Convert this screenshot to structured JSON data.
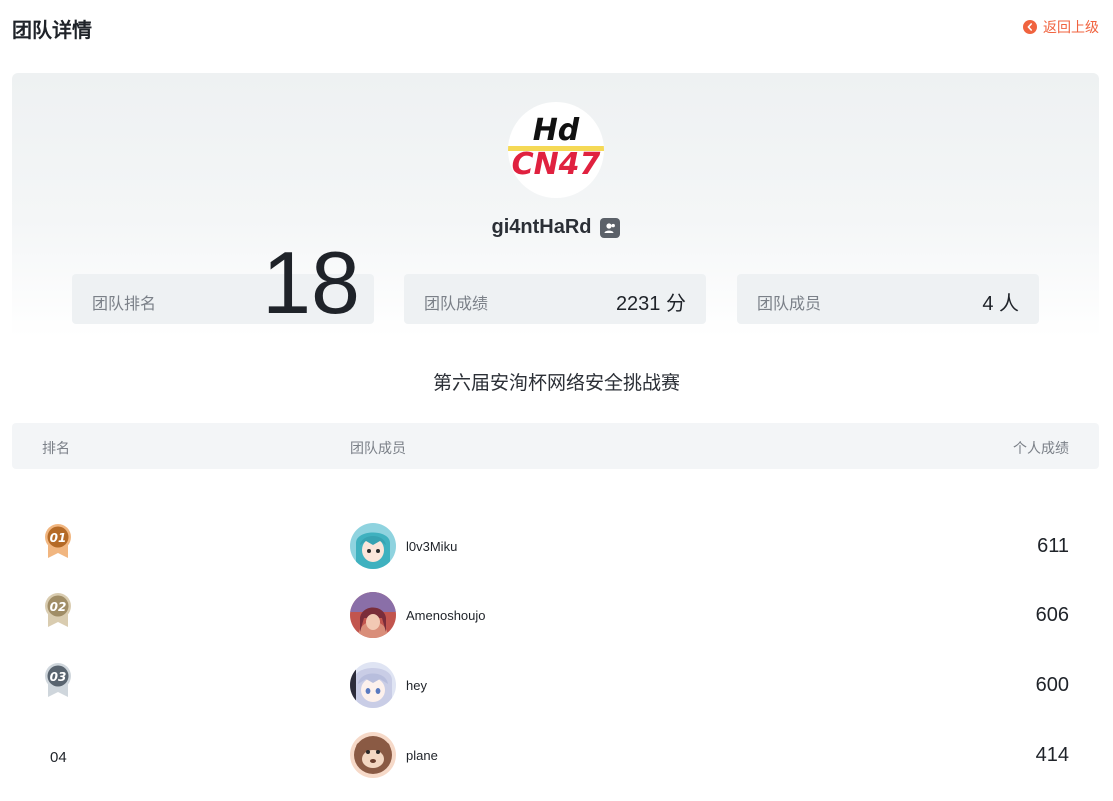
{
  "page": {
    "title": "团队详情",
    "back_label": "返回上级"
  },
  "team": {
    "name": "gi4ntHaRd",
    "logo_text_top": "Hd",
    "logo_text_bottom": "CN47"
  },
  "stats": [
    {
      "label": "团队排名",
      "value": "18"
    },
    {
      "label": "团队成绩",
      "value": "2231",
      "unit": "分"
    },
    {
      "label": "团队成员",
      "value": "4",
      "unit": "人"
    }
  ],
  "contest": {
    "title": "第六届安洵杯网络安全挑战赛"
  },
  "table": {
    "headers": {
      "rank": "排名",
      "member": "团队成员",
      "score": "个人成绩"
    },
    "rows": [
      {
        "rank": "01",
        "name": "l0v3Miku",
        "score": "611",
        "medal_color": "#b87333"
      },
      {
        "rank": "02",
        "name": "Amenoshoujo",
        "score": "606",
        "medal_color": "#a89670"
      },
      {
        "rank": "03",
        "name": "hey",
        "score": "600",
        "medal_color": "#5b6673"
      },
      {
        "rank": "04",
        "name": "plane",
        "score": "414"
      }
    ]
  },
  "colors": {
    "accent": "#f0633f",
    "text": "#1f2329",
    "muted": "#7b8088"
  },
  "icons": {
    "back": "chevron-left-icon",
    "team_badge": "team-users-icon"
  }
}
